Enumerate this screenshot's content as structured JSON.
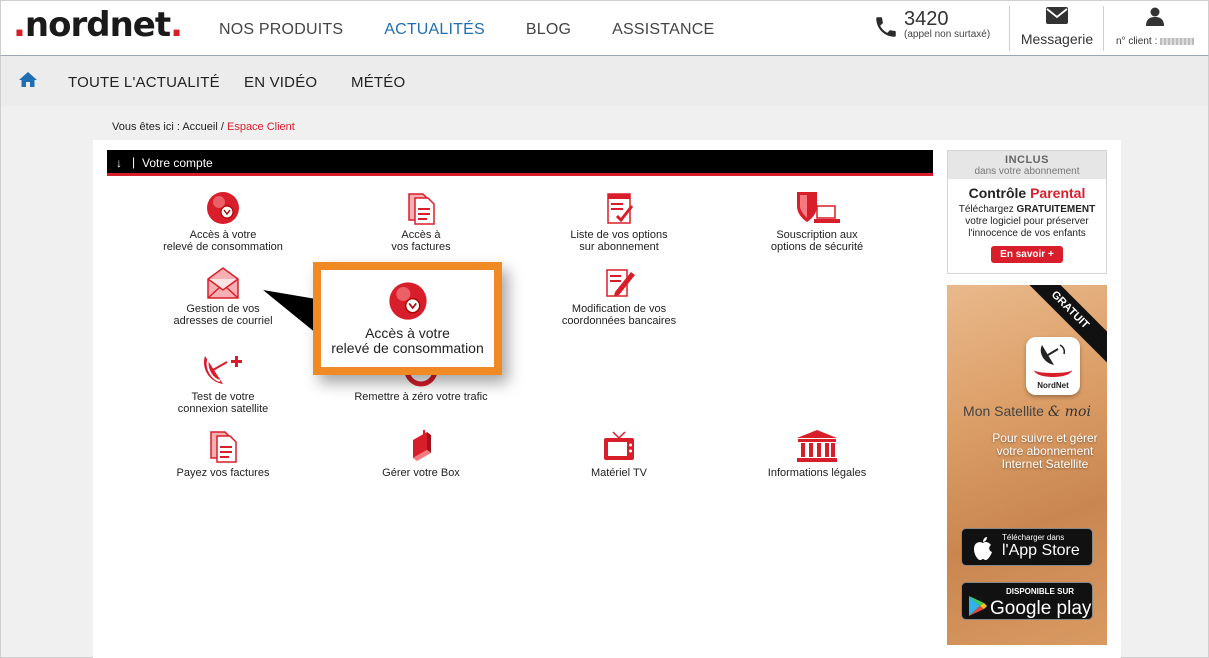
{
  "header": {
    "logo": "nordnet",
    "nav": [
      {
        "label": "NOS PRODUITS",
        "active": false
      },
      {
        "label": "ACTUALITÉS",
        "active": true
      },
      {
        "label": "BLOG",
        "active": false
      },
      {
        "label": "ASSISTANCE",
        "active": false
      }
    ],
    "phone_number": "3420",
    "phone_note": "(appel non surtaxé)",
    "messages_label": "Messagerie",
    "client_label": "n° client :"
  },
  "subnav": {
    "items": [
      "TOUTE L'ACTUALITÉ",
      "EN VIDÉO",
      "MÉTÉO"
    ]
  },
  "breadcrumb": {
    "prefix": "Vous êtes ici :",
    "home": "Accueil",
    "sep": "/",
    "current": "Espace Client"
  },
  "account": {
    "title": "Votre compte",
    "tiles": [
      {
        "line1": "Accès à votre",
        "line2": "relevé de consommation",
        "icon": "meter-icon"
      },
      {
        "line1": "Accès à",
        "line2": "vos factures",
        "icon": "documents-icon"
      },
      {
        "line1": "Liste de vos options",
        "line2": "sur abonnement",
        "icon": "checklist-icon"
      },
      {
        "line1": "Souscription aux",
        "line2": "options de sécurité",
        "icon": "shield-computer-icon"
      },
      {
        "line1": "Gestion de vos",
        "line2": "adresses de courriel",
        "icon": "envelope-icon"
      },
      {
        "line1": "Modification de vos",
        "line2": "coordonnées bancaires",
        "icon": "edit-icon"
      },
      {
        "line1": "Test de votre",
        "line2": "connexion satellite",
        "icon": "satellite-dish-icon"
      },
      {
        "line1": "Remettre à zéro votre trafic",
        "line2": "",
        "icon": "reset-icon"
      },
      {
        "line1": "Payez vos factures",
        "line2": "",
        "icon": "invoice-icon"
      },
      {
        "line1": "Gérer votre Box",
        "line2": "",
        "icon": "router-icon"
      },
      {
        "line1": "Matériel TV",
        "line2": "",
        "icon": "tv-icon"
      },
      {
        "line1": "Informations légales",
        "line2": "",
        "icon": "courthouse-icon"
      }
    ],
    "popup": {
      "line1": "Accès à votre",
      "line2": "relevé de consommation"
    }
  },
  "promo": {
    "badge_line1": "INCLUS",
    "badge_line2": "dans votre abonnement",
    "title_main": "Contrôle",
    "title_accent": "Parental",
    "body_lead": "Téléchargez",
    "body_strong": "GRATUITEMENT",
    "body_rest1": "votre logiciel pour préserver",
    "body_rest2": "l'innocence de vos enfants",
    "button": "En savoir +"
  },
  "ad": {
    "ribbon": "GRATUIT",
    "app_brand": "NordNet",
    "name_plain": "Mon Satellite",
    "name_script": "& moi",
    "copy1": "Pour suivre et gérer",
    "copy2": "votre abonnement",
    "copy3": "Internet Satellite",
    "appstore_small": "Télécharger dans",
    "appstore_big": "l'App Store",
    "gplay_small": "DISPONIBLE SUR",
    "gplay_big": "Google play"
  },
  "colors": {
    "brand_red": "#d81e2a",
    "nav_blue": "#1f6fb2",
    "highlight_orange": "#f08a24"
  }
}
